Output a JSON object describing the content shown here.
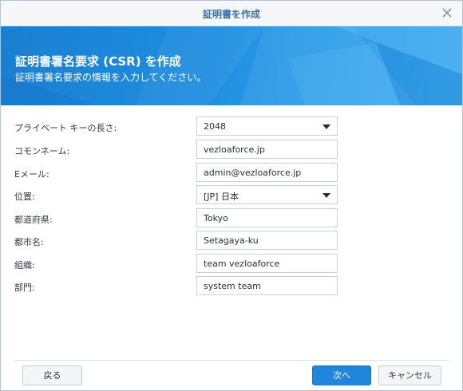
{
  "window": {
    "title": "証明書を作成"
  },
  "banner": {
    "title": "証明書署名要求 (CSR) を作成",
    "subtitle": "証明書署名要求の情報を入力してください。"
  },
  "form": {
    "key_length": {
      "label": "プライベート キーの長さ:",
      "value": "2048"
    },
    "common_name": {
      "label": "コモンネーム:",
      "value": "vezloaforce.jp"
    },
    "email": {
      "label": "Eメール:",
      "value": "admin@vezloaforce.jp"
    },
    "country": {
      "label": "位置:",
      "value": "[JP] 日本"
    },
    "state": {
      "label": "都道府県:",
      "value": "Tokyo"
    },
    "city": {
      "label": "都市名:",
      "value": "Setagaya-ku"
    },
    "organization": {
      "label": "組織:",
      "value": "team vezloaforce"
    },
    "department": {
      "label": "部門:",
      "value": "system team"
    }
  },
  "footer": {
    "back_label": "戻る",
    "next_label": "次へ",
    "cancel_label": "キャンセル"
  },
  "icons": {
    "close": "close-icon",
    "dropdown": "chevron-down-icon"
  },
  "colors": {
    "title": "#3a6fb0",
    "banner": "#1f8ee0",
    "primary_button": "#2086dc"
  }
}
